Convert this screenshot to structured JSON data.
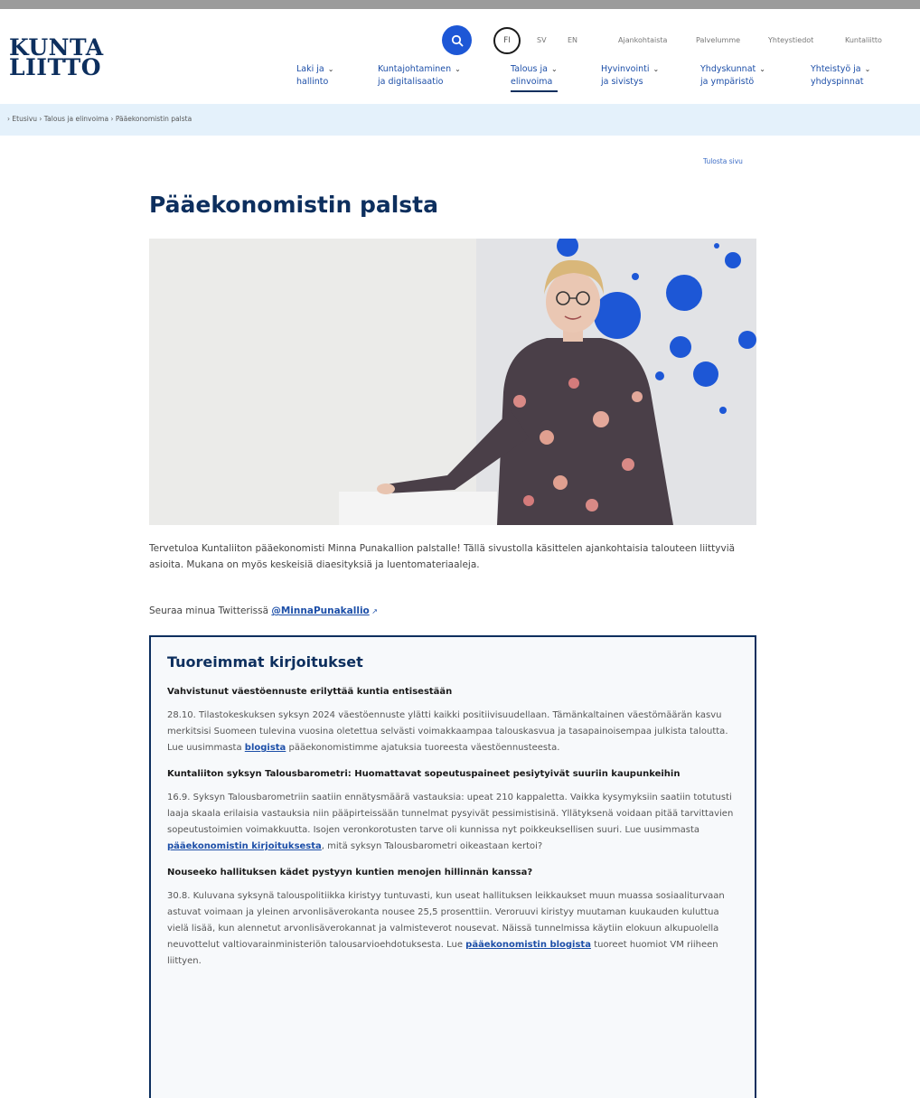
{
  "header": {
    "logo_line1": "KUNTA",
    "logo_line2": "LIITTO",
    "lang_fi": "FI",
    "lang_sv": "SV",
    "lang_en": "EN",
    "utility_links": [
      "Ajankohtaista",
      "Palvelumme",
      "Yhteystiedot",
      "Kuntaliitto"
    ]
  },
  "nav": {
    "items": [
      {
        "line1": "Laki ja",
        "line2": "hallinto"
      },
      {
        "line1": "Kuntajohtaminen",
        "line2": "ja digitalisaatio"
      },
      {
        "line1": "Talous ja",
        "line2": "elinvoima"
      },
      {
        "line1": "Hyvinvointi",
        "line2": "ja sivistys"
      },
      {
        "line1": "Yhdyskunnat",
        "line2": "ja ympäristö"
      },
      {
        "line1": "Yhteistyö ja",
        "line2": "yhdyspinnat"
      }
    ]
  },
  "breadcrumb": {
    "items": [
      "Etusivu",
      "Talous ja elinvoima",
      "Pääekonomistin palsta"
    ]
  },
  "page": {
    "print_link": "Tulosta sivu",
    "title": "Pääekonomistin palsta",
    "intro": "Tervetuloa Kuntaliiton pääekonomisti Minna Punakallion palstalle! Tällä sivustolla käsittelen ajankohtaisia talouteen liittyviä asioita. Mukana on myös keskeisiä diaesityksiä ja luentomateriaaleja.",
    "follow_text": "Seuraa minua Twitterissä ",
    "follow_link": "@MinnaPunakallio"
  },
  "news": {
    "title": "Tuoreimmat kirjoitukset",
    "items": [
      {
        "heading": "Vahvistunut väestöennuste erilyttää kuntia entisestään",
        "body_before": "28.10. Tilastokeskuksen syksyn 2024 väestöennuste ylätti kaikki positiivisuudellaan. Tämänkaltainen väestömäärän kasvu merkitsisi Suomeen tulevina vuosina oletettua selvästi voimakkaampaa talouskasvua ja tasapainoisempaa julkista taloutta. Lue uusimmasta ",
        "link": "blogista",
        "body_after": " pääekonomistimme ajatuksia tuoreesta väestöennusteesta."
      },
      {
        "heading": "Kuntaliiton syksyn Talousbarometri: Huomattavat sopeutuspaineet pesiytyivät suuriin kaupunkeihin",
        "body_before": "16.9. Syksyn Talousbarometriin saatiin ennätysmäärä vastauksia: upeat 210 kappaletta. Vaikka kysymyksiin saatiin totutusti laaja skaala erilaisia vastauksia niin pääpirteissään tunnelmat pysyivät pessimistisinä. Yllätyksenä voidaan pitää tarvittavien sopeutustoimien voimakkuutta. Isojen veronkorotusten tarve oli kunnissa nyt poikkeuksellisen suuri. Lue uusimmasta ",
        "link": "pääekonomistin kirjoituksesta",
        "body_after": ", mitä syksyn Talousbarometri oikeastaan kertoi?"
      },
      {
        "heading": "Nouseeko hallituksen kädet pystyyn kuntien menojen hillinnän kanssa?",
        "body_before": "30.8. Kuluvana syksynä talouspolitiikka kiristyy tuntuvasti, kun useat hallituksen leikkaukset muun muassa sosiaaliturvaan astuvat voimaan ja yleinen arvonlisäverokanta nousee 25,5 prosenttiin. Veroruuvi kiristyy muutaman kuukauden kuluttua vielä lisää, kun alennetut arvonlisäverokannat ja valmisteverot nousevat. Näissä tunnelmissa käytiin elokuun alkupuolella neuvottelut valtiovarainministeriön talousarvioehdotuksesta. Lue ",
        "link": "pääekonomistin blogista",
        "body_after": " tuoreet huomiot VM riiheen liittyen."
      }
    ]
  },
  "colors": {
    "brand_navy": "#0d2f5e",
    "link_blue": "#1d4fa8",
    "search_blue": "#1d57d6",
    "breadcrumb_bg": "#e4f1fb"
  }
}
